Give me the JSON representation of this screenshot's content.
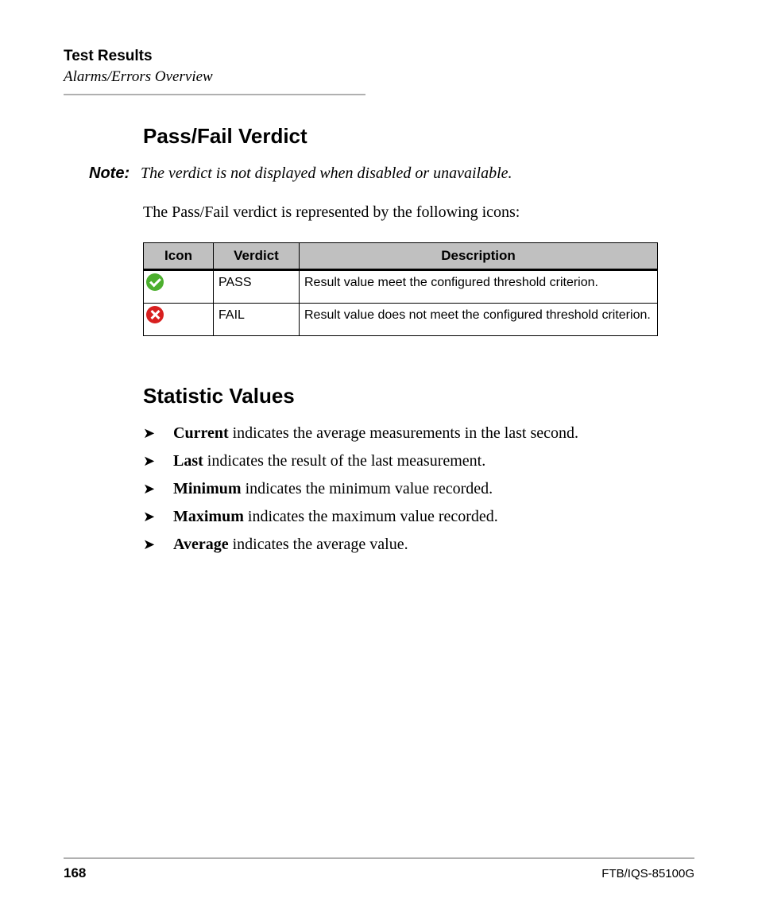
{
  "header": {
    "title": "Test Results",
    "subtitle": "Alarms/Errors Overview"
  },
  "section1": {
    "heading": "Pass/Fail Verdict",
    "note_label": "Note:",
    "note_text": "The verdict is not displayed when disabled or unavailable.",
    "intro": "The Pass/Fail verdict is represented by the following icons:"
  },
  "table": {
    "headers": {
      "icon": "Icon",
      "verdict": "Verdict",
      "desc": "Description"
    },
    "rows": [
      {
        "verdict": "PASS",
        "desc": "Result value meet the configured threshold criterion."
      },
      {
        "verdict": "FAIL",
        "desc": "Result value does not meet the configured threshold criterion."
      }
    ]
  },
  "section2": {
    "heading": "Statistic Values",
    "items": [
      {
        "bold": "Current",
        "rest": " indicates the average measurements in the last second."
      },
      {
        "bold": "Last",
        "rest": " indicates the result of the last measurement."
      },
      {
        "bold": "Minimum",
        "rest": " indicates the minimum value recorded."
      },
      {
        "bold": "Maximum",
        "rest": " indicates the maximum value recorded."
      },
      {
        "bold": "Average",
        "rest": " indicates the average value."
      }
    ]
  },
  "footer": {
    "page": "168",
    "doc": "FTB/IQS-85100G"
  }
}
